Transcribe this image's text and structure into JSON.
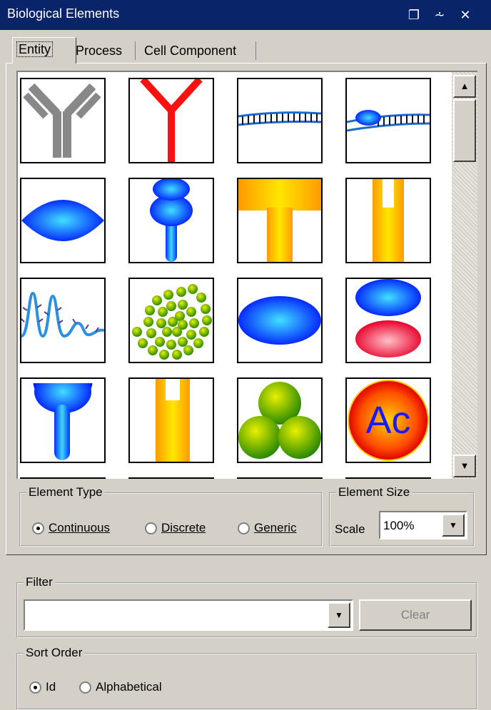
{
  "window": {
    "title": "Biological Elements"
  },
  "titlebar_icons": [
    "restore-icon",
    "pin-icon",
    "close-icon"
  ],
  "tabs": [
    {
      "label": "Entity",
      "active": true
    },
    {
      "label": "Process",
      "active": false
    },
    {
      "label": "Cell Component",
      "active": false
    }
  ],
  "palette": {
    "items": [
      {
        "icon": "antibody-gray-icon"
      },
      {
        "icon": "receptor-red-icon"
      },
      {
        "icon": "dna-strand-icon"
      },
      {
        "icon": "dna-with-protein-icon"
      },
      {
        "icon": "blue-ellipse-icon"
      },
      {
        "icon": "blue-receptor-stack-icon"
      },
      {
        "icon": "orange-t-block-icon"
      },
      {
        "icon": "orange-channel-icon"
      },
      {
        "icon": "rna-loops-icon"
      },
      {
        "icon": "green-bead-spiral-icon"
      },
      {
        "icon": "blue-oval-icon"
      },
      {
        "icon": "blue-red-ellipses-icon"
      },
      {
        "icon": "blue-cup-receptor-icon"
      },
      {
        "icon": "orange-slot-channel-icon"
      },
      {
        "icon": "green-sphere-cluster-icon"
      },
      {
        "icon": "acetyl-circle-icon",
        "label": "Ac"
      }
    ]
  },
  "element_type": {
    "legend": "Element Type",
    "options": [
      {
        "label": "Continuous",
        "selected": true
      },
      {
        "label": "Discrete",
        "selected": false
      },
      {
        "label": "Generic",
        "selected": false
      }
    ]
  },
  "element_size": {
    "legend": "Element Size",
    "scale_label": "Scale",
    "scale_value": "100%"
  },
  "filter": {
    "legend": "Filter",
    "value": "",
    "clear_label": "Clear"
  },
  "sort_order": {
    "legend": "Sort Order",
    "options": [
      {
        "label": "Id",
        "selected": true
      },
      {
        "label": "Alphabetical",
        "selected": false
      }
    ]
  },
  "colors": {
    "titlebar": "#0a246a",
    "chrome": "#d4d0c8"
  }
}
